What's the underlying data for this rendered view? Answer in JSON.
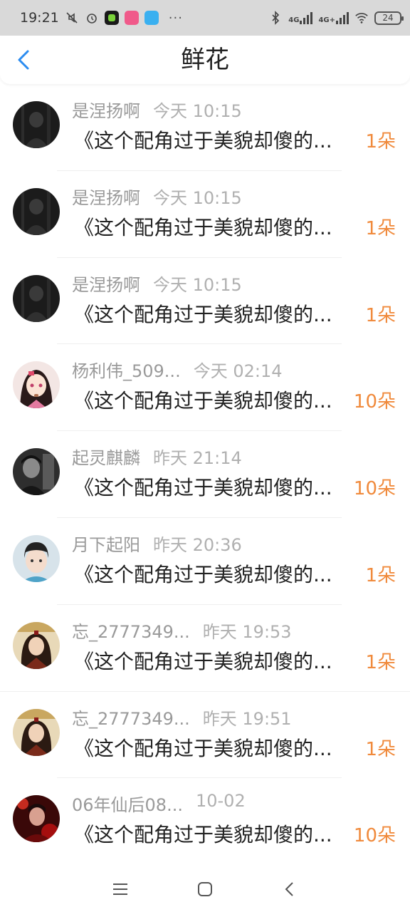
{
  "status_bar": {
    "time": "19:21",
    "battery": "24",
    "network_1": "4G",
    "network_2": "4G+",
    "more": "···"
  },
  "header": {
    "title": "鲜花"
  },
  "items": [
    {
      "name": "是涅扬啊",
      "time": "今天 10:15",
      "message": "《这个配角过于美貌却傻的...",
      "count": "1朵",
      "avatar_icon": "avatar-dark-figure"
    },
    {
      "name": "是涅扬啊",
      "time": "今天 10:15",
      "message": "《这个配角过于美貌却傻的...",
      "count": "1朵",
      "avatar_icon": "avatar-dark-figure"
    },
    {
      "name": "是涅扬啊",
      "time": "今天 10:15",
      "message": "《这个配角过于美貌却傻的...",
      "count": "1朵",
      "avatar_icon": "avatar-dark-figure"
    },
    {
      "name": "杨利伟_509...",
      "time": "今天 02:14",
      "message": "《这个配角过于美貌却傻的...",
      "count": "10朵",
      "avatar_icon": "avatar-anime-girl"
    },
    {
      "name": "起灵麒麟",
      "time": "昨天 21:14",
      "message": "《这个配角过于美貌却傻的...",
      "count": "10朵",
      "avatar_icon": "avatar-dark-portrait"
    },
    {
      "name": "月下起阳",
      "time": "昨天 20:36",
      "message": "《这个配角过于美貌却傻的...",
      "count": "1朵",
      "avatar_icon": "avatar-boy-portrait"
    },
    {
      "name": "忘_2777349...",
      "time": "昨天 19:53",
      "message": "《这个配角过于美貌却傻的...",
      "count": "1朵",
      "avatar_icon": "avatar-ancient-character"
    },
    {
      "name": "忘_2777349...",
      "time": "昨天 19:51",
      "message": "《这个配角过于美貌却傻的...",
      "count": "1朵",
      "avatar_icon": "avatar-ancient-character"
    },
    {
      "name": "06年仙后08...",
      "time": "10-02",
      "message": "《这个配角过于美貌却傻的...",
      "count": "10朵",
      "avatar_icon": "avatar-red-stage"
    }
  ],
  "colors": {
    "accent": "#2b8cf0",
    "count": "#f08a3c",
    "meta": "#9a9a9a"
  }
}
